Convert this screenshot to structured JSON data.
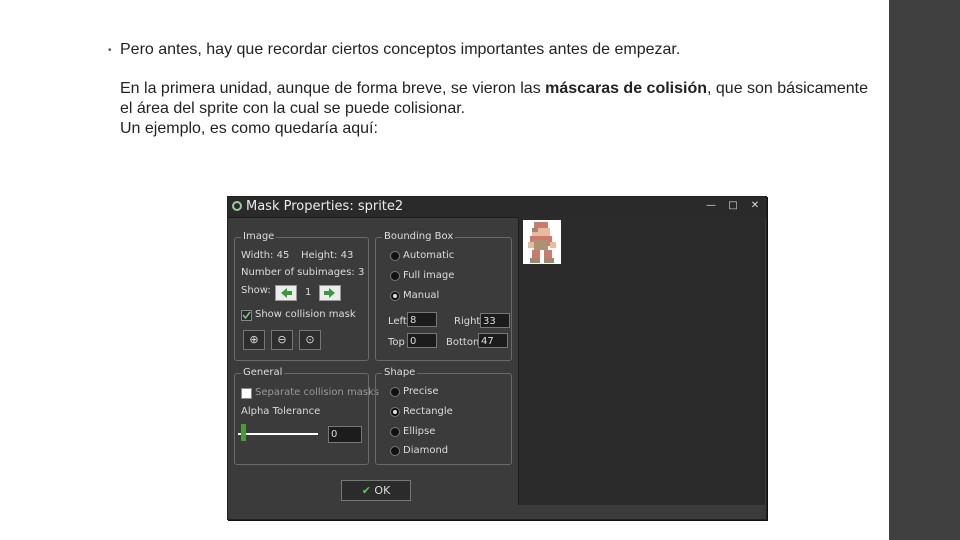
{
  "slide": {
    "bullet": "•",
    "line1": "Pero antes, hay que recordar ciertos conceptos importantes antes de empezar.",
    "p1": "En la primera unidad, aunque de forma breve, se vieron las ",
    "p1_bold": "máscaras de colisión",
    "p1_rest": ", que son básicamente el área del sprite con la cual se puede colisionar.",
    "p2": "Un ejemplo, es como quedaría aquí:"
  },
  "dialog": {
    "title": "Mask Properties: sprite2",
    "image_group": {
      "title": "Image",
      "width": "Width: 45",
      "height": "Height: 43",
      "subimages": "Number of subimages: 3",
      "show_label": "Show:",
      "show_value": "1",
      "show_mask": "Show collision mask"
    },
    "bbox_group": {
      "title": "Bounding Box",
      "options": [
        "Automatic",
        "Full image",
        "Manual"
      ],
      "selected": "Manual",
      "left_label": "Left",
      "left_value": "8",
      "right_label": "Right",
      "right_value": "33",
      "top_label": "Top",
      "top_value": "0",
      "bottom_label": "Bottom",
      "bottom_value": "47"
    },
    "general_group": {
      "title": "General",
      "separate": "Separate collision masks",
      "alpha_label": "Alpha Tolerance",
      "alpha_value": "0"
    },
    "shape_group": {
      "title": "Shape",
      "options": [
        "Precise",
        "Rectangle",
        "Ellipse",
        "Diamond"
      ],
      "selected": "Rectangle"
    },
    "ok_label": "OK"
  }
}
